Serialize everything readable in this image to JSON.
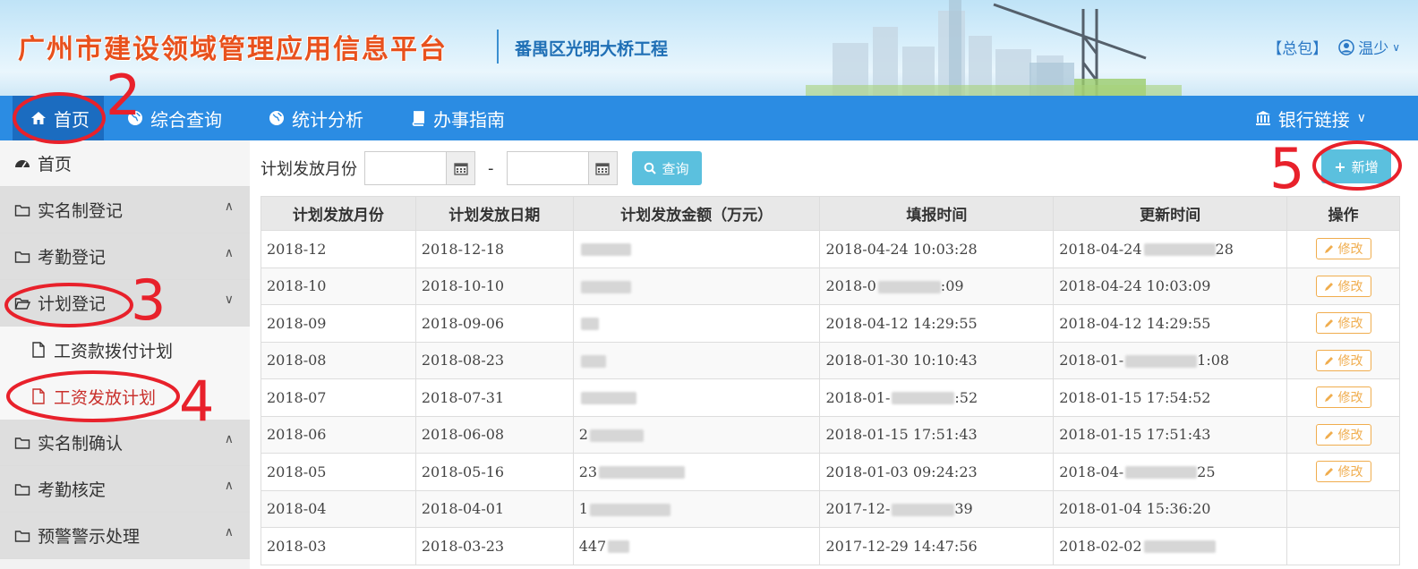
{
  "header": {
    "site_title": "广州市建设领域管理应用信息平台",
    "project_name": "番禺区光明大桥工程",
    "package_label": "【总包】",
    "user_name": "温少"
  },
  "nav": {
    "items": [
      {
        "label": "首页",
        "icon": "home-icon"
      },
      {
        "label": "综合查询",
        "icon": "globe-icon"
      },
      {
        "label": "统计分析",
        "icon": "globe-icon"
      },
      {
        "label": "办事指南",
        "icon": "book-icon"
      }
    ],
    "bank_link": "银行链接"
  },
  "sidebar": {
    "home": "首页",
    "groups": [
      {
        "label": "实名制登记"
      },
      {
        "label": "考勤登记"
      },
      {
        "label": "计划登记"
      },
      {
        "label": "实名制确认"
      },
      {
        "label": "考勤核定"
      },
      {
        "label": "预警警示处理"
      }
    ],
    "sub_items": [
      {
        "label": "工资款拨付计划"
      },
      {
        "label": "工资发放计划"
      }
    ]
  },
  "filter": {
    "label": "计划发放月份",
    "start_value": "",
    "end_value": "",
    "separator": "-",
    "query_button": "查询",
    "add_button": "新增"
  },
  "table": {
    "headers": [
      "计划发放月份",
      "计划发放日期",
      "计划发放金额（万元）",
      "填报时间",
      "更新时间",
      "操作"
    ],
    "edit_label": "修改",
    "rows": [
      {
        "month": "2018-12",
        "date": "2018-12-18",
        "amount": "",
        "filled": "2018-04-24 10:03:28",
        "updated": "2018-04-24",
        "updated_tail": "28"
      },
      {
        "month": "2018-10",
        "date": "2018-10-10",
        "amount": "",
        "filled": "2018-0",
        "filled_tail": ":09",
        "updated": "2018-04-24 10:03:09"
      },
      {
        "month": "2018-09",
        "date": "2018-09-06",
        "amount": "",
        "filled": "2018-04-12 14:29:55",
        "updated": "2018-04-12 14:29:55"
      },
      {
        "month": "2018-08",
        "date": "2018-08-23",
        "amount": "",
        "filled": "2018-01-30 10:10:43",
        "updated": "2018-01-",
        "updated_tail": "1:08"
      },
      {
        "month": "2018-07",
        "date": "2018-07-31",
        "amount": "",
        "filled": "2018-01-",
        "filled_tail": ":52",
        "updated": "2018-01-15 17:54:52"
      },
      {
        "month": "2018-06",
        "date": "2018-06-08",
        "amount": "2",
        "filled": "2018-01-15 17:51:43",
        "updated": "2018-01-15 17:51:43"
      },
      {
        "month": "2018-05",
        "date": "2018-05-16",
        "amount": "23",
        "filled": "2018-01-03 09:24:23",
        "updated": "2018-04-",
        "updated_tail": "25"
      },
      {
        "month": "2018-04",
        "date": "2018-04-01",
        "amount": "1",
        "filled": "2017-12-",
        "filled_tail": "39",
        "updated": "2018-01-04 15:36:20"
      },
      {
        "month": "2018-03",
        "date": "2018-03-23",
        "amount": "447",
        "filled": "2017-12-29 14:47:56",
        "updated": "2018-02-02",
        "updated_tail": ""
      }
    ]
  },
  "annotations": [
    "2",
    "3",
    "4",
    "5"
  ],
  "colors": {
    "nav": "#2b8ce3",
    "nav_active": "#1b6cc0",
    "accent_btn": "#5bc0de",
    "edit": "#f0ad4e",
    "annotation": "#e8212b",
    "title": "#e8511d"
  }
}
